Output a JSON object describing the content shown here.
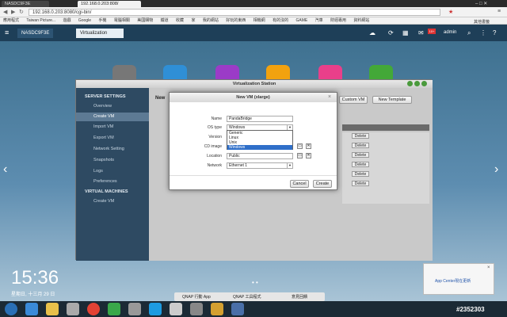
{
  "browser": {
    "tabs": [
      "NASDC9F3E",
      "192.168.0.203:808/"
    ],
    "url": "192.168.0.203:8080/cgi-bin/",
    "bookmarks": [
      "應用程式",
      "Taiwan Picture...",
      "遊戲",
      "Google",
      "手機",
      "電腦相關",
      "美國購物",
      "鐵道",
      "收藏",
      "家",
      "我的網站",
      "好玩的東西",
      "相機網",
      "有的沒的",
      "GAME",
      "汽車",
      "財經專用",
      "資料網站",
      "其他書籤"
    ]
  },
  "nas": {
    "tab_label": "NASDC9F3E",
    "app_tab_label": "Virtualization",
    "user": "admin"
  },
  "window": {
    "title": "Virtualization Station",
    "sidebar": {
      "server_header": "SERVER SETTINGS",
      "server_items": [
        "Overview",
        "Create VM",
        "Import VM",
        "Export VM",
        "Network Setting",
        "Snapshots",
        "Logs",
        "Preferences"
      ],
      "vm_header": "VIRTUAL MACHINES",
      "vm_items": [
        "Create VM"
      ]
    },
    "toolbar": {
      "new_label": "New",
      "custom_vm": "Custom VM",
      "new_template": "New Template"
    },
    "row_button": "Delete"
  },
  "dialog": {
    "title": "New VM (xlarge)",
    "labels": {
      "name": "Name",
      "os_type": "OS type",
      "version": "Version",
      "cd_image": "CD image",
      "location": "Location",
      "network": "Network"
    },
    "values": {
      "name": "PandaBridge",
      "os_type": "Windows",
      "location": "Public",
      "network": "Ethernet 1"
    },
    "os_options": [
      "Generic",
      "Linux",
      "Unix",
      "Windows"
    ],
    "cancel": "Cancel",
    "create": "Create"
  },
  "desktop": {
    "time": "15:36",
    "date": "星期日, 十三月 29 日",
    "notification": "App Center現在更新",
    "taskbar_items": [
      "QNAP 行動 App",
      "QNAP 工具程式",
      "意見回饋"
    ],
    "watermark": "#2352303"
  },
  "colors": {
    "sidebar": "#2e4a62",
    "highlight": "#2f6fc9",
    "nasbar": "#1e3f58"
  }
}
